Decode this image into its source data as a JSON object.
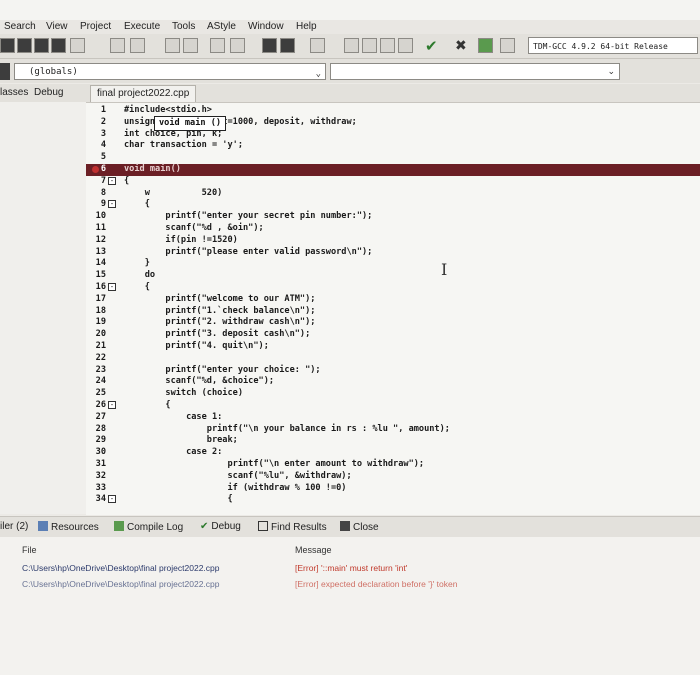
{
  "menu": [
    "Search",
    "View",
    "Project",
    "Execute",
    "Tools",
    "AStyle",
    "Window",
    "Help"
  ],
  "toolbar": {
    "compiler": "TDM-GCC 4.9.2 64-bit Release",
    "scope": "(globals)"
  },
  "left_tabs": [
    "lasses",
    "Debug"
  ],
  "editor_tab": "final project2022.cpp",
  "tooltip": "void main ()",
  "code_lines": [
    {
      "n": "1",
      "text": "#include<stdio.h>"
    },
    {
      "n": "2",
      "text": "unsigned long amount=1000, deposit, withdraw;"
    },
    {
      "n": "3",
      "text": "int choice, pin, k;"
    },
    {
      "n": "4",
      "text": "char transaction = 'y';"
    },
    {
      "n": "5",
      "text": ""
    },
    {
      "n": "6",
      "text": "void main()"
    },
    {
      "n": "7",
      "text": "{"
    },
    {
      "n": "8",
      "text": "    w          520)"
    },
    {
      "n": "9",
      "text": "    {"
    },
    {
      "n": "10",
      "text": "        printf(\"enter your secret pin number:\");"
    },
    {
      "n": "11",
      "text": "        scanf(\"%d , &oin\");"
    },
    {
      "n": "12",
      "text": "        if(pin !=1520)"
    },
    {
      "n": "13",
      "text": "        printf(\"please enter valid password\\n\");"
    },
    {
      "n": "14",
      "text": "    }"
    },
    {
      "n": "15",
      "text": "    do"
    },
    {
      "n": "16",
      "text": "    {"
    },
    {
      "n": "17",
      "text": "        printf(\"welcome to our ATM\");"
    },
    {
      "n": "18",
      "text": "        printf(\"1.`check balance\\n\");"
    },
    {
      "n": "19",
      "text": "        printf(\"2. withdraw cash\\n\");"
    },
    {
      "n": "20",
      "text": "        printf(\"3. deposit cash\\n\");"
    },
    {
      "n": "21",
      "text": "        printf(\"4. quit\\n\");"
    },
    {
      "n": "22",
      "text": ""
    },
    {
      "n": "23",
      "text": "        printf(\"enter your choice: \");"
    },
    {
      "n": "24",
      "text": "        scanf(\"%d, &choice\");"
    },
    {
      "n": "25",
      "text": "        switch (choice)"
    },
    {
      "n": "26",
      "text": "        {"
    },
    {
      "n": "27",
      "text": "            case 1:"
    },
    {
      "n": "28",
      "text": "                printf(\"\\n your balance in rs : %lu \", amount);"
    },
    {
      "n": "29",
      "text": "                break;"
    },
    {
      "n": "30",
      "text": "            case 2:"
    },
    {
      "n": "31",
      "text": "                    printf(\"\\n enter amount to withdraw\");"
    },
    {
      "n": "32",
      "text": "                    scanf(\"%lu\", &withdraw);"
    },
    {
      "n": "33",
      "text": "                    if (withdraw % 100 !=0)"
    },
    {
      "n": "34",
      "text": "                    {"
    }
  ],
  "bottom_tabs": [
    "iler (2)",
    "Resources",
    "Compile Log",
    "Debug",
    "Find Results",
    "Close"
  ],
  "messages": {
    "col_file": "File",
    "col_message": "Message",
    "rows": [
      {
        "file": "C:\\Users\\hp\\OneDrive\\Desktop\\final project2022.cpp",
        "message": "[Error] '::main' must return 'int'"
      },
      {
        "file": "C:\\Users\\hp\\OneDrive\\Desktop\\final project2022.cpp",
        "message": "[Error] expected declaration before '}' token"
      }
    ]
  },
  "colors": {
    "highlight_line": "#6b1f25",
    "error_text": "#c0392b"
  }
}
